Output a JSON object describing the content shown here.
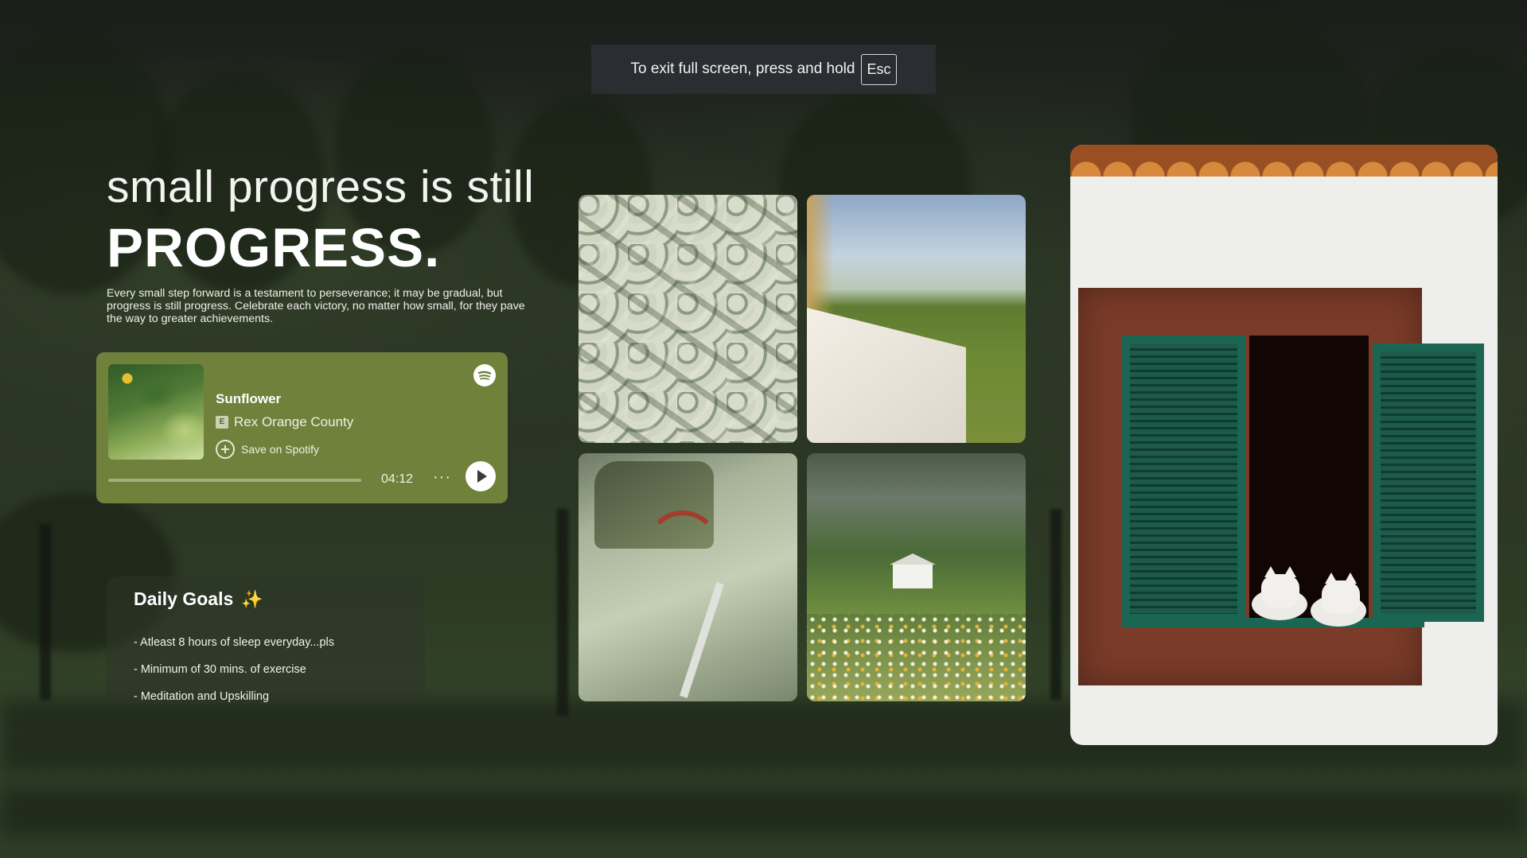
{
  "fullscreen_notice": {
    "text": "To exit full screen, press and hold",
    "key": "Esc"
  },
  "hero": {
    "line1": "small progress is still",
    "line2": "PROGRESS.",
    "description": "Every small step forward is a testament to perseverance; it may be gradual, but progress is still progress. Celebrate each victory, no matter how small, for they pave the way to greater achievements."
  },
  "player": {
    "track": "Sunflower",
    "explicit_badge": "E",
    "artist": "Rex Orange County",
    "save_label": "Save on Spotify",
    "duration": "04:12",
    "more": "···",
    "progress": 0,
    "accent_color": "#70813c"
  },
  "goals": {
    "title": "Daily Goals",
    "icon": "✨",
    "items": [
      "- Atleast 8 hours of sleep everyday...pls",
      "- Minimum of 30 mins. of exercise",
      "- Meditation and Upskilling"
    ]
  }
}
